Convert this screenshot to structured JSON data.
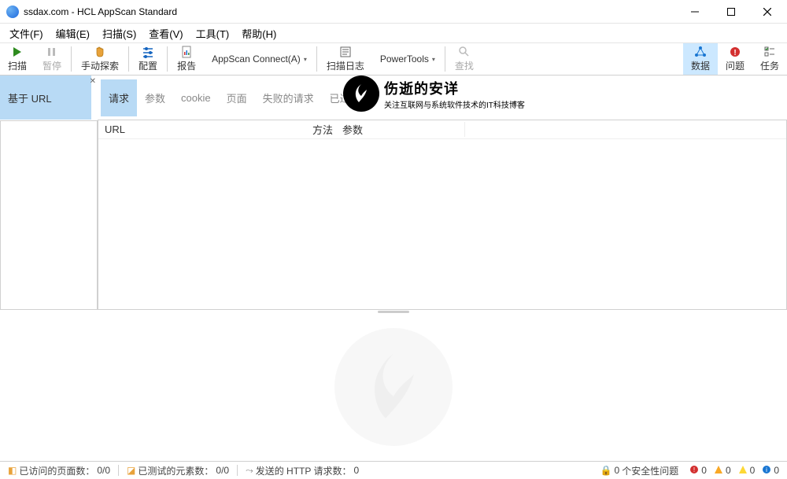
{
  "title": "ssdax.com - HCL AppScan Standard",
  "menu": {
    "file": "文件(F)",
    "edit": "编辑(E)",
    "scan": "扫描(S)",
    "view": "查看(V)",
    "tools": "工具(T)",
    "help": "帮助(H)"
  },
  "toolbar": {
    "scan": "扫描",
    "pause": "暂停",
    "manual": "手动探索",
    "config": "配置",
    "report": "报告",
    "connect": "AppScan Connect(A)",
    "log": "扫描日志",
    "power": "PowerTools",
    "find": "查找",
    "data": "数据",
    "issues": "问题",
    "tasks": "任务"
  },
  "left_tab": "基于 URL",
  "sub_tabs": {
    "request": "请求",
    "params": "参数",
    "cookie": "cookie",
    "page": "页面",
    "failed": "失败的请求",
    "filtered": "已过滤"
  },
  "grid": {
    "url": "URL",
    "method": "方法",
    "param": "参数"
  },
  "watermark": {
    "title": "伤逝的安详",
    "sub": "关注互联网与系统软件技术的IT科技博客"
  },
  "status": {
    "pages_label": "已访问的页面数：",
    "pages_val": "0/0",
    "tested_label": "已测试的元素数：",
    "tested_val": "0/0",
    "sent_label": "发送的 HTTP 请求数：",
    "sent_val": "0",
    "sec_label": "个安全性问题",
    "sec_val": "0",
    "sev_vals": {
      "critical": "0",
      "high": "0",
      "med": "0",
      "low": "0"
    }
  }
}
